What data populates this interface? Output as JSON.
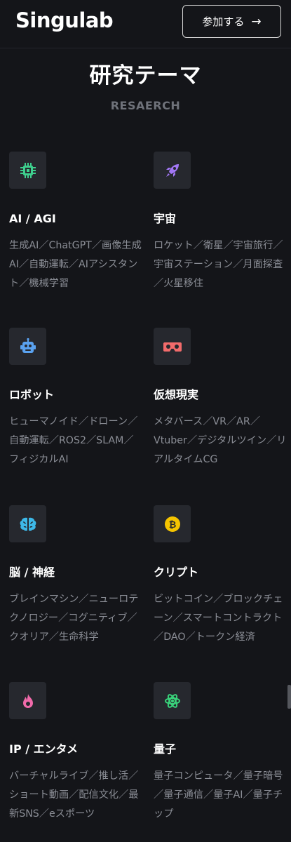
{
  "header": {
    "logo": "Singulab",
    "join_label": "参加する",
    "join_arrow": "→"
  },
  "section": {
    "title": "研究テーマ",
    "subtitle": "RESAERCH"
  },
  "cards": [
    {
      "icon": "chip-icon",
      "color": "#3ecf8e",
      "title": "AI / AGI",
      "desc": "生成AI／ChatGPT／画像生成AI／自動運転／AIアシスタント／機械学習"
    },
    {
      "icon": "rocket-icon",
      "color": "#a277f5",
      "title": "宇宙",
      "desc": "ロケット／衛星／宇宙旅行／宇宙ステーション／月面探査／火星移住"
    },
    {
      "icon": "robot-icon",
      "color": "#5aa2f0",
      "title": "ロボット",
      "desc": "ヒューマノイド／ドローン／自動運転／ROS2／SLAM／フィジカルAI"
    },
    {
      "icon": "vr-headset-icon",
      "color": "#f26b6b",
      "title": "仮想現実",
      "desc": "メタバース／VR／AR／Vtuber／デジタルツイン／リアルタイムCG"
    },
    {
      "icon": "brain-icon",
      "color": "#3db8e8",
      "title": "脳 / 神経",
      "desc": "ブレインマシン／ニューロテクノロジー／コグニティブ／クオリア／生命科学"
    },
    {
      "icon": "bitcoin-icon",
      "color": "#f5c400",
      "title": "クリプト",
      "desc": "ビットコイン／ブロックチェーン／スマートコントラクト／DAO／トークン経済"
    },
    {
      "icon": "flame-icon",
      "color": "#f06aaa",
      "title": "IP / エンタメ",
      "desc": "バーチャルライブ／推し活／ショート動画／配信文化／最新SNS／eスポーツ"
    },
    {
      "icon": "atom-icon",
      "color": "#39d17a",
      "title": "量子",
      "desc": "量子コンピュータ／量子暗号／量子通信／量子AI／量子チップ"
    }
  ]
}
